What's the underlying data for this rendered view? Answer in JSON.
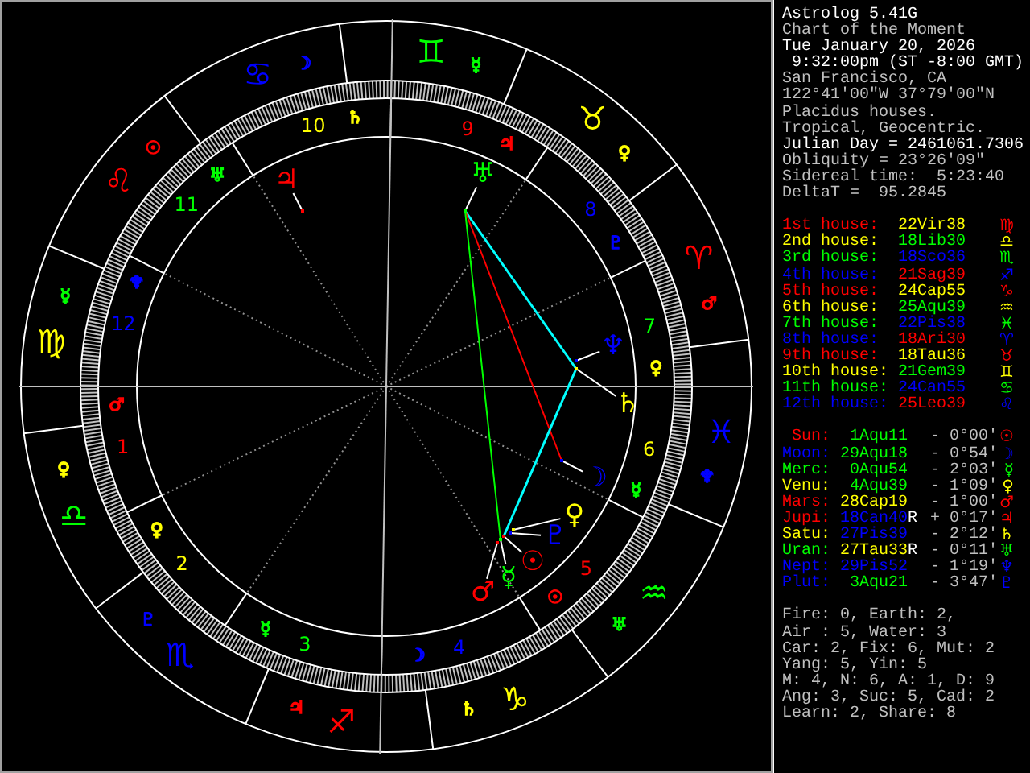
{
  "wheel": {
    "signs": [
      {
        "glyph": "♈",
        "color": "#ff0000",
        "ruler": {
          "glyph": "♂",
          "color": "#ff0000"
        }
      },
      {
        "glyph": "♉",
        "color": "#ffff00",
        "ruler": {
          "glyph": "♀",
          "color": "#ffff00"
        }
      },
      {
        "glyph": "♊",
        "color": "#00ff00",
        "ruler": {
          "glyph": "☿",
          "color": "#00ff00"
        }
      },
      {
        "glyph": "♋",
        "color": "#0000ff",
        "ruler": {
          "glyph": "☽",
          "color": "#0000ff"
        }
      },
      {
        "glyph": "♌",
        "color": "#ff0000",
        "ruler": {
          "glyph": "☉",
          "color": "#ff0000"
        }
      },
      {
        "glyph": "♍",
        "color": "#ffff00",
        "ruler": {
          "glyph": "☿",
          "color": "#00ff00"
        }
      },
      {
        "glyph": "♎",
        "color": "#00ff00",
        "ruler": {
          "glyph": "♀",
          "color": "#ffff00"
        }
      },
      {
        "glyph": "♏",
        "color": "#0000ff",
        "ruler": {
          "glyph": "♇",
          "color": "#0000ff"
        }
      },
      {
        "glyph": "♐",
        "color": "#ff0000",
        "ruler": {
          "glyph": "♃",
          "color": "#ff0000"
        }
      },
      {
        "glyph": "♑",
        "color": "#ffff00",
        "ruler": {
          "glyph": "♄",
          "color": "#ffff00"
        }
      },
      {
        "glyph": "♒",
        "color": "#00ff00",
        "ruler": {
          "glyph": "♅",
          "color": "#00ff00"
        }
      },
      {
        "glyph": "♓",
        "color": "#0000ff",
        "ruler": {
          "glyph": "♆",
          "color": "#0000ff"
        }
      }
    ],
    "houses": [
      {
        "number": "1",
        "color": "#ff0000",
        "ruler": {
          "glyph": "♂",
          "color": "#ff0000"
        }
      },
      {
        "number": "2",
        "color": "#ffff00",
        "ruler": {
          "glyph": "♀",
          "color": "#ffff00"
        }
      },
      {
        "number": "3",
        "color": "#00ff00",
        "ruler": {
          "glyph": "☿",
          "color": "#00ff00"
        }
      },
      {
        "number": "4",
        "color": "#0000ff",
        "ruler": {
          "glyph": "☽",
          "color": "#0000ff"
        }
      },
      {
        "number": "5",
        "color": "#ff0000",
        "ruler": {
          "glyph": "☉",
          "color": "#ff0000"
        }
      },
      {
        "number": "6",
        "color": "#ffff00",
        "ruler": {
          "glyph": "☿",
          "color": "#00ff00"
        }
      },
      {
        "number": "7",
        "color": "#00ff00",
        "ruler": {
          "glyph": "♀",
          "color": "#ffff00"
        }
      },
      {
        "number": "8",
        "color": "#0000ff",
        "ruler": {
          "glyph": "♇",
          "color": "#0000ff"
        }
      },
      {
        "number": "9",
        "color": "#ff0000",
        "ruler": {
          "glyph": "♃",
          "color": "#ff0000"
        }
      },
      {
        "number": "10",
        "color": "#ffff00",
        "ruler": {
          "glyph": "♄",
          "color": "#ffff00"
        }
      },
      {
        "number": "11",
        "color": "#00ff00",
        "ruler": {
          "glyph": "♅",
          "color": "#00ff00"
        }
      },
      {
        "number": "12",
        "color": "#0000ff",
        "ruler": {
          "glyph": "♆",
          "color": "#0000ff"
        }
      }
    ],
    "planets": [
      {
        "glyph": "☉",
        "color": "#ff0000"
      },
      {
        "glyph": "☽",
        "color": "#0000ff"
      },
      {
        "glyph": "☿",
        "color": "#00ff00"
      },
      {
        "glyph": "♀",
        "color": "#ffff00"
      },
      {
        "glyph": "♂",
        "color": "#ff0000"
      },
      {
        "glyph": "♃",
        "color": "#ff0000"
      },
      {
        "glyph": "♄",
        "color": "#ffff00"
      },
      {
        "glyph": "♅",
        "color": "#00ff00"
      },
      {
        "glyph": "♆",
        "color": "#0000ff"
      },
      {
        "glyph": "♇",
        "color": "#0000ff"
      }
    ]
  },
  "info": {
    "lines": [
      {
        "text": "Astrolog 5.41G",
        "kind": "bright"
      },
      {
        "text": "Chart of the Moment",
        "kind": "normal"
      },
      {
        "text": "Tue January 20, 2026",
        "kind": "bright"
      },
      {
        "text": " 9:32:00pm (ST -8:00 GMT)",
        "kind": "bright"
      },
      {
        "text": "San Francisco, CA",
        "kind": "normal"
      },
      {
        "text": "122°41'00\"W 37°79'00\"N",
        "kind": "normal"
      },
      {
        "text": "Placidus houses.",
        "kind": "normal"
      },
      {
        "text": "Tropical, Geocentric.",
        "kind": "normal"
      },
      {
        "text": "Julian Day = 2461061.7306",
        "kind": "bright"
      },
      {
        "text": "Obliquity = 23°26'09\"",
        "kind": "normal"
      },
      {
        "text": "Sidereal time:  5:23:40",
        "kind": "normal"
      },
      {
        "text": "DeltaT =  95.2845",
        "kind": "normal"
      }
    ],
    "houses": [
      {
        "label": "1st house:",
        "color": "#ff0000",
        "position": {
          "text": "22Vir38",
          "color": "#ffff00"
        },
        "glyph": "♍"
      },
      {
        "label": "2nd house:",
        "color": "#ffff00",
        "position": {
          "text": "18Lib30",
          "color": "#00ff00"
        },
        "glyph": "♎"
      },
      {
        "label": "3rd house:",
        "color": "#00ff00",
        "position": {
          "text": "18Sco36",
          "color": "#0000ff"
        },
        "glyph": "♏"
      },
      {
        "label": "4th house:",
        "color": "#0000ff",
        "position": {
          "text": "21Sag39",
          "color": "#ff0000"
        },
        "glyph": "♐"
      },
      {
        "label": "5th house:",
        "color": "#ff0000",
        "position": {
          "text": "24Cap55",
          "color": "#ffff00"
        },
        "glyph": "♑"
      },
      {
        "label": "6th house:",
        "color": "#ffff00",
        "position": {
          "text": "25Aqu39",
          "color": "#00ff00"
        },
        "glyph": "♒"
      },
      {
        "label": "7th house:",
        "color": "#00ff00",
        "position": {
          "text": "22Pis38",
          "color": "#0000ff"
        },
        "glyph": "♓"
      },
      {
        "label": "8th house:",
        "color": "#0000ff",
        "position": {
          "text": "18Ari30",
          "color": "#ff0000"
        },
        "glyph": "♈"
      },
      {
        "label": "9th house:",
        "color": "#ff0000",
        "position": {
          "text": "18Tau36",
          "color": "#ffff00"
        },
        "glyph": "♉"
      },
      {
        "label": "10th house:",
        "color": "#ffff00",
        "position": {
          "text": "21Gem39",
          "color": "#00ff00"
        },
        "glyph": "♊"
      },
      {
        "label": "11th house:",
        "color": "#00ff00",
        "position": {
          "text": "24Can55",
          "color": "#0000ff"
        },
        "glyph": "♋"
      },
      {
        "label": "12th house:",
        "color": "#0000ff",
        "position": {
          "text": "25Leo39",
          "color": "#ff0000"
        },
        "glyph": "♌"
      }
    ],
    "planets": [
      {
        "name": "Sun:",
        "color": "#ff0000",
        "position": {
          "text": "1Aqu11",
          "color": "#00ff00"
        },
        "deviation": "- 0°00'",
        "glyph": "☉"
      },
      {
        "name": "Moon:",
        "color": "#0000ff",
        "position": {
          "text": "29Aqu18",
          "color": "#00ff00"
        },
        "deviation": "- 0°54'",
        "glyph": "☽"
      },
      {
        "name": "Merc:",
        "color": "#00ff00",
        "position": {
          "text": "0Aqu54",
          "color": "#00ff00"
        },
        "deviation": "- 2°03'",
        "glyph": "☿"
      },
      {
        "name": "Venu:",
        "color": "#ffff00",
        "position": {
          "text": "4Aqu39",
          "color": "#00ff00"
        },
        "deviation": "- 1°09'",
        "glyph": "♀"
      },
      {
        "name": "Mars:",
        "color": "#ff0000",
        "position": {
          "text": "28Cap19",
          "color": "#ffff00"
        },
        "deviation": "- 1°00'",
        "glyph": "♂"
      },
      {
        "name": "Jupi:",
        "color": "#ff0000",
        "position": {
          "text": "18Can40",
          "color": "#0000ff"
        },
        "retro": "R",
        "deviation": "+ 0°17'",
        "glyph": "♃"
      },
      {
        "name": "Satu:",
        "color": "#ffff00",
        "position": {
          "text": "27Pis39",
          "color": "#0000ff"
        },
        "deviation": "- 2°12'",
        "glyph": "♄"
      },
      {
        "name": "Uran:",
        "color": "#00ff00",
        "position": {
          "text": "27Tau33",
          "color": "#ffff00"
        },
        "retro": "R",
        "deviation": "- 0°11'",
        "glyph": "♅"
      },
      {
        "name": "Nept:",
        "color": "#0000ff",
        "position": {
          "text": "29Pis52",
          "color": "#0000ff"
        },
        "deviation": "- 1°19'",
        "glyph": "♆"
      },
      {
        "name": "Plut:",
        "color": "#0000ff",
        "position": {
          "text": "3Aqu21",
          "color": "#00ff00"
        },
        "deviation": "- 3°47'",
        "glyph": "♇"
      }
    ],
    "summary": [
      "Fire: 0, Earth: 2,",
      "Air : 5, Water: 3",
      "Car: 2, Fix: 6, Mut: 2",
      "Yang: 5, Yin: 5",
      "M: 4, N: 6, A: 1, D: 9",
      "Ang: 3, Suc: 5, Cad: 2",
      "Learn: 2, Share: 8"
    ]
  }
}
